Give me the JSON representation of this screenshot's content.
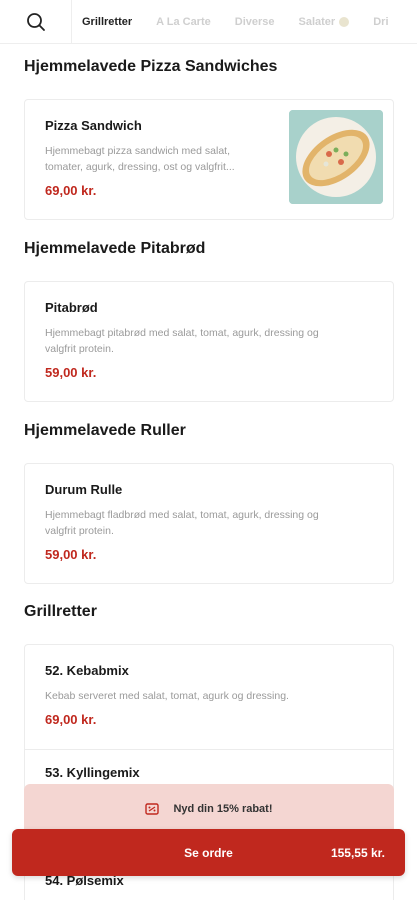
{
  "nav": {
    "search_icon": "search-icon",
    "tabs": [
      {
        "label": "Grillretter"
      },
      {
        "label": "A La Carte"
      },
      {
        "label": "Diverse"
      },
      {
        "label": "Salater"
      },
      {
        "label": "Dri"
      }
    ],
    "active_tab": "Grillretter"
  },
  "sections": [
    {
      "title": "Hjemmelavede Pizza Sandwiches",
      "items": [
        {
          "name": "Pizza Sandwich",
          "desc_line1": "Hjemmebagt pizza sandwich med salat,",
          "desc_line2": "tomater, agurk, dressing, ost og valgfrit...",
          "price": "69,00 kr.",
          "image": "pizza-sandwich-photo"
        }
      ]
    },
    {
      "title": "Hjemmelavede Pitabrød",
      "items": [
        {
          "name": "Pitabrød",
          "desc_line1": "Hjemmebagt pitabrød med salat, tomat, agurk, dressing og",
          "desc_line2": "valgfrit protein.",
          "price": "59,00 kr."
        }
      ]
    },
    {
      "title": "Hjemmelavede Ruller",
      "items": [
        {
          "name": "Durum Rulle",
          "desc_line1": "Hjemmebagt fladbrød med salat, tomat, agurk, dressing og",
          "desc_line2": "valgfrit protein.",
          "price": "59,00 kr."
        }
      ]
    },
    {
      "title": "Grillretter",
      "items": [
        {
          "name": "52. Kebabmix",
          "desc_line1": "Kebab serveret med salat, tomat, agurk og dressing.",
          "price": "69,00 kr."
        },
        {
          "name": "53. Kyllingemix"
        },
        {
          "name": "54. Pølsemix"
        }
      ]
    }
  ],
  "discount_banner": {
    "text": "Nyd din 15% rabat!",
    "icon": "discount-ticket-icon"
  },
  "order_bar": {
    "label": "Se ordre",
    "total": "155,55 kr."
  },
  "colors": {
    "accent": "#c0281e",
    "banner": "#f4d6d2"
  }
}
